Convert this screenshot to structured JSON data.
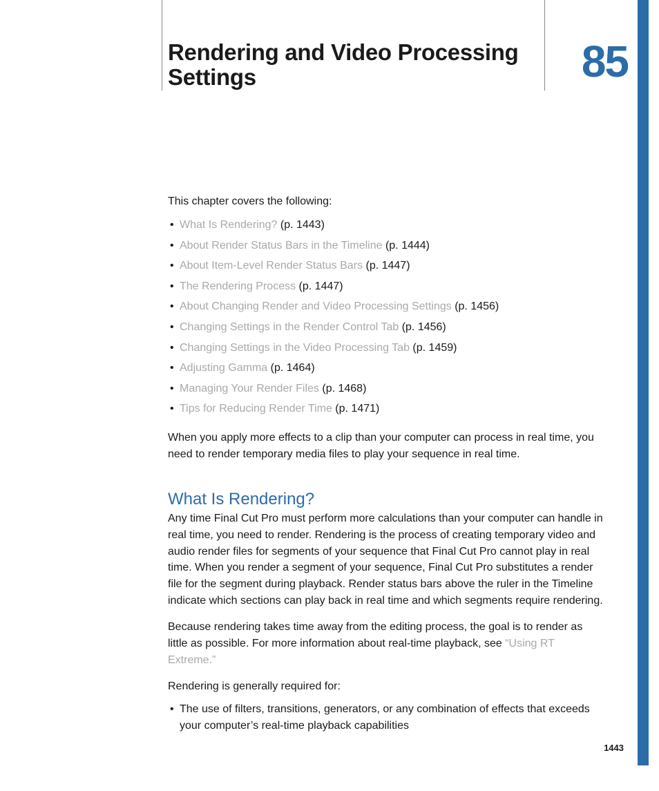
{
  "chapter": {
    "number": "85",
    "title": "Rendering and Video Processing Settings"
  },
  "intro": "This chapter covers the following:",
  "toc": [
    {
      "label": "What Is Rendering?",
      "page": "(p. 1443)"
    },
    {
      "label": "About Render Status Bars in the Timeline",
      "page": "(p. 1444)"
    },
    {
      "label": "About Item-Level Render Status Bars",
      "page": "(p. 1447)"
    },
    {
      "label": "The Rendering Process",
      "page": "(p. 1447)"
    },
    {
      "label": "About Changing Render and Video Processing Settings",
      "page": "(p. 1456)"
    },
    {
      "label": "Changing Settings in the Render Control Tab",
      "page": "(p. 1456)"
    },
    {
      "label": "Changing Settings in the Video Processing Tab",
      "page": "(p. 1459)"
    },
    {
      "label": "Adjusting Gamma",
      "page": "(p. 1464)"
    },
    {
      "label": "Managing Your Render Files",
      "page": "(p. 1468)"
    },
    {
      "label": "Tips for Reducing Render Time",
      "page": "(p. 1471)"
    }
  ],
  "lead_para": "When you apply more effects to a clip than your computer can process in real time, you need to render temporary media files to play your sequence in real time.",
  "section": {
    "heading": "What Is Rendering?",
    "p1": "Any time Final Cut Pro must perform more calculations than your computer can handle in real time, you need to render. Rendering is the process of creating temporary video and audio render files for segments of your sequence that Final Cut Pro cannot play in real time. When you render a segment of your sequence, Final Cut Pro substitutes a render file for the segment during playback. Render status bars above the ruler in the Timeline indicate which sections can play back in real time and which segments require rendering.",
    "p2_prefix": "Because rendering takes time away from the editing process, the goal is to render as little as possible. For more information about real-time playback, see ",
    "p2_link": "“Using RT Extreme.”",
    "p3": "Rendering is generally required for:",
    "bullet1": "The use of filters, transitions, generators, or any combination of effects that exceeds your computer’s real-time playback capabilities"
  },
  "page_number": "1443"
}
